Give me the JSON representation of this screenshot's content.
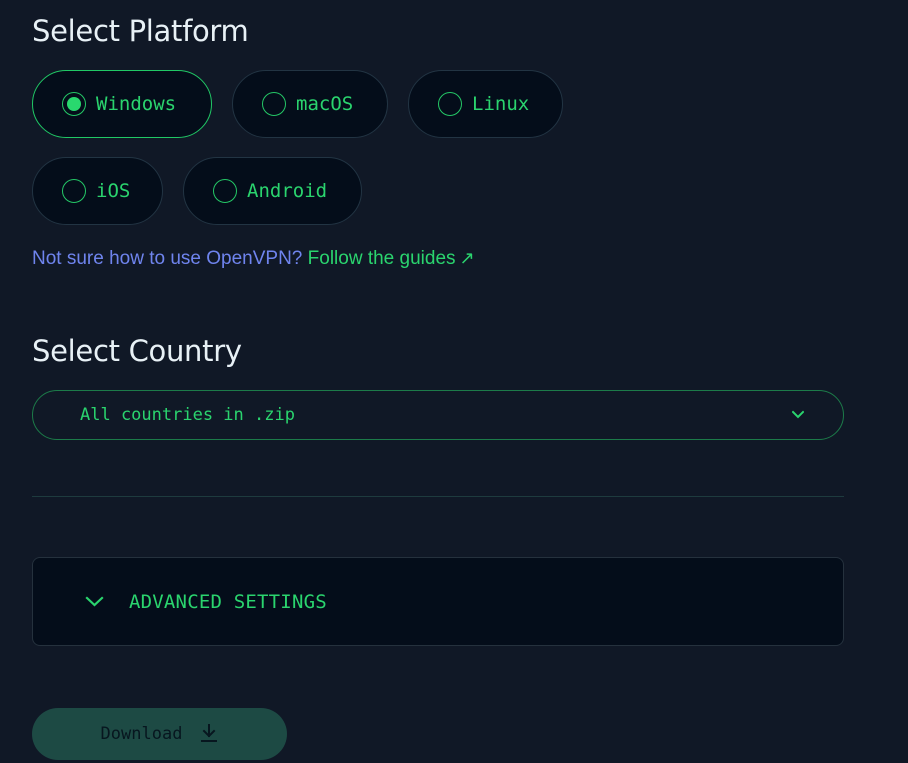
{
  "platform": {
    "title": "Select Platform",
    "options": [
      {
        "label": "Windows",
        "selected": true
      },
      {
        "label": "macOS",
        "selected": false
      },
      {
        "label": "Linux",
        "selected": false
      },
      {
        "label": "iOS",
        "selected": false
      },
      {
        "label": "Android",
        "selected": false
      }
    ],
    "help_text": "Not sure how to use OpenVPN?",
    "guide_link": "Follow the guides"
  },
  "country": {
    "title": "Select Country",
    "selected_value": "All countries in .zip"
  },
  "advanced": {
    "label": "ADVANCED SETTINGS"
  },
  "download": {
    "label": "Download"
  },
  "colors": {
    "background": "#101826",
    "accent": "#2ad46e",
    "link_blue": "#6f84ee",
    "download_button": "#1d4a44"
  },
  "icons": {
    "selected_radio": "radio-selected-icon",
    "radio": "radio-icon",
    "external_link": "external-link-icon",
    "dropdown": "chevron-down-icon",
    "download": "download-icon"
  }
}
